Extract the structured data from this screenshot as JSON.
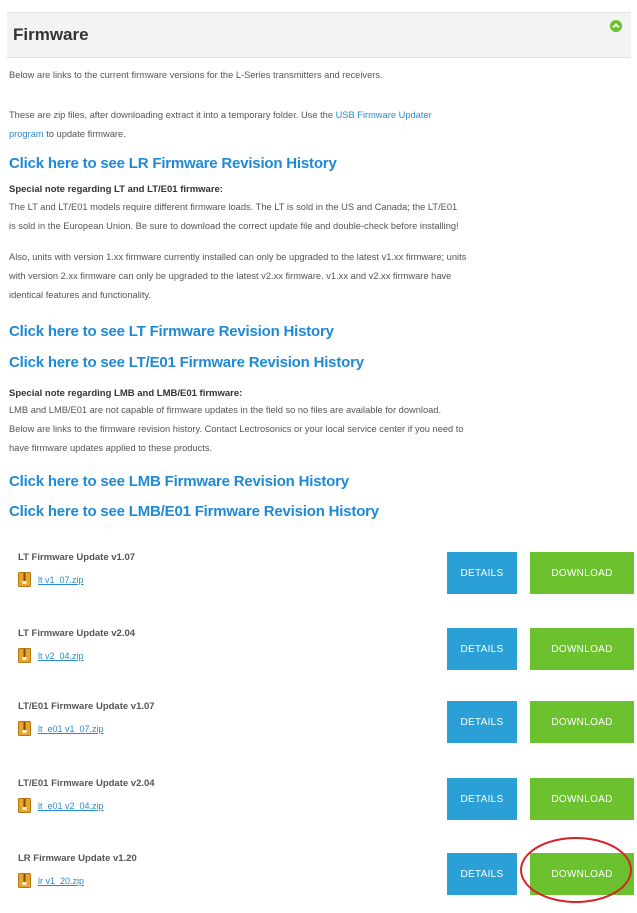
{
  "section": {
    "title": "Firmware"
  },
  "intro": {
    "line1": "Below are links to the current firmware versions for the L-Series transmitters and receivers.",
    "line2_pre": "These are zip files, after downloading extract it into a temporary folder. Use the ",
    "line2_link": "USB Firmware Updater",
    "line2_link2": "program",
    "line2_post": " to update firmware."
  },
  "links": {
    "lr_history": "Click here to see LR Firmware Revision History",
    "lt_history": "Click here to see LT Firmware Revision History",
    "lte01_history": "Click here to see LT/E01 Firmware Revision History",
    "lmb_history": "Click here to see LMB Firmware Revision History",
    "lmbe01_history": "Click here to see LMB/E01 Firmware Revision History"
  },
  "note_lt": {
    "title": "Special note regarding LT and LT/E01 firmware:",
    "line1": "The LT and LT/E01 models require different firmware loads. The LT is sold in the US and Canada; the LT/E01",
    "line2": "is sold in the European Union. Be sure to download the correct update file and double-check before installing!",
    "line3": "Also, units with version 1.xx firmware currently installed can only be upgraded to the latest v1.xx firmware; units",
    "line4": "with version 2.xx firmware can only be upgraded to the latest v2.xx firmware. v1.xx and v2.xx firmware have",
    "line5": "identical features and functionality."
  },
  "note_lmb": {
    "title": "Special note regarding LMB and LMB/E01 firmware:",
    "line1": "LMB and LMB/E01 are not capable of firmware updates in the field so no files are available for download.",
    "line2": "Below are links to the firmware revision history. Contact Lectrosonics or your local service center if you need to",
    "line3": "have firmware updates applied to these products."
  },
  "buttons": {
    "details": "DETAILS",
    "download": "DOWNLOAD"
  },
  "updates": [
    {
      "title": "LT Firmware Update v1.07",
      "file": "lt v1_07.zip"
    },
    {
      "title": "LT Firmware Update v2.04",
      "file": "lt v2_04.zip"
    },
    {
      "title": "LT/E01 Firmware Update v1.07",
      "file": "lt_e01 v1_07.zip"
    },
    {
      "title": "LT/E01 Firmware Update v2.04",
      "file": "lt_e01 v2_04.zip"
    },
    {
      "title": "LR Firmware Update v1.20",
      "file": "lr v1_20.zip"
    }
  ],
  "colors": {
    "link": "#1e8ad6",
    "details_button": "#2aa0d6",
    "download_button": "#6cc12e",
    "highlight": "#d8222a"
  }
}
